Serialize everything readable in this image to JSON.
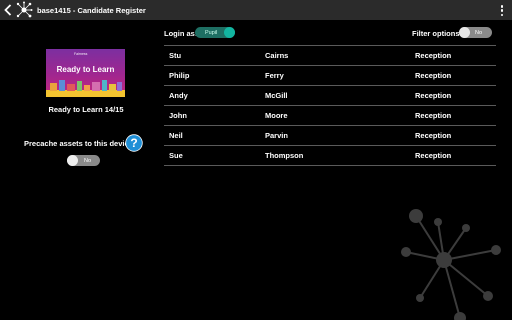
{
  "app": {
    "title": "base1415 - Candidate Register"
  },
  "course": {
    "thumbnail_title": "Ready to Learn",
    "thumbnail_brand": "Fairness",
    "name": "Ready to Learn 14/15"
  },
  "precache": {
    "label": "Precache assets to this device:",
    "value": "No"
  },
  "login": {
    "label": "Login as:",
    "value": "Pupil"
  },
  "filter": {
    "label": "Filter options:",
    "value": "No"
  },
  "candidates": [
    {
      "first": "Stu",
      "last": "Cairns",
      "location": "Reception"
    },
    {
      "first": "Philip",
      "last": "Ferry",
      "location": "Reception"
    },
    {
      "first": "Andy",
      "last": "McGill",
      "location": "Reception"
    },
    {
      "first": "John",
      "last": "Moore",
      "location": "Reception"
    },
    {
      "first": "Neil",
      "last": "Parvin",
      "location": "Reception"
    },
    {
      "first": "Sue",
      "last": "Thompson",
      "location": "Reception"
    }
  ],
  "icons": {
    "back": "chevron-left-icon",
    "logo": "molecule-logo-icon",
    "menu": "overflow-menu-icon",
    "help": "help-icon"
  },
  "colors": {
    "topbar": "#2b2b2b",
    "accent": "#12b5a0",
    "help": "#1f8fd6",
    "thumbnail": "#a1268f"
  }
}
